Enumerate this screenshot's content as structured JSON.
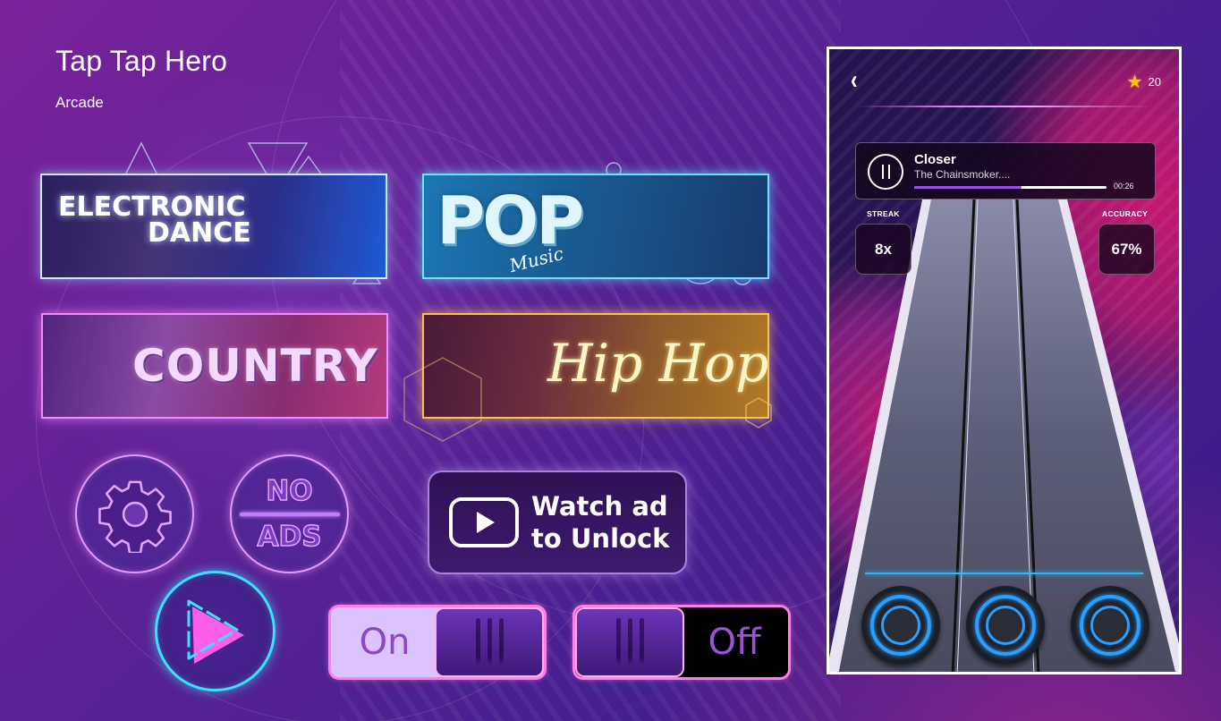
{
  "header": {
    "title": "Tap Tap Hero",
    "category": "Arcade"
  },
  "genres": [
    {
      "id": "electronic-dance",
      "line1": "ELECTRONIC",
      "line2": "DANCE",
      "accent": "#cfe9ff"
    },
    {
      "id": "pop",
      "title": "POP",
      "subtitle": "Music",
      "accent": "#6fe3ff"
    },
    {
      "id": "country",
      "title": "COUNTRY",
      "accent": "#f08bff"
    },
    {
      "id": "hip-hop",
      "title": "Hip Hop",
      "accent": "#f5c44a"
    }
  ],
  "buttons": {
    "settings_icon": "gear-icon",
    "no_ads_top": "NO",
    "no_ads_bottom": "ADS",
    "play_icon": "play-icon",
    "watch_ad_line1": "Watch ad",
    "watch_ad_line2": "to Unlock",
    "watch_ad_icon": "video-play-icon"
  },
  "toggles": {
    "on": {
      "label": "On",
      "state": true
    },
    "off": {
      "label": "Off",
      "state": false
    }
  },
  "game_screen": {
    "back_icon": "double-chevron-left-icon",
    "stars": "20",
    "now_playing": {
      "title": "Closer",
      "artist": "The Chainsmoker....",
      "time": "00:26",
      "progress_percent": 56
    },
    "streak_label": "STREAK",
    "streak_value": "8x",
    "accuracy_label": "ACCURACY",
    "accuracy_value": "67%",
    "lanes": 3
  },
  "colors": {
    "accent_cyan": "#3de0ff",
    "accent_pink": "#ff7fe6",
    "accent_purple": "#9a4fe0",
    "pad_blue": "#2a9fff"
  }
}
